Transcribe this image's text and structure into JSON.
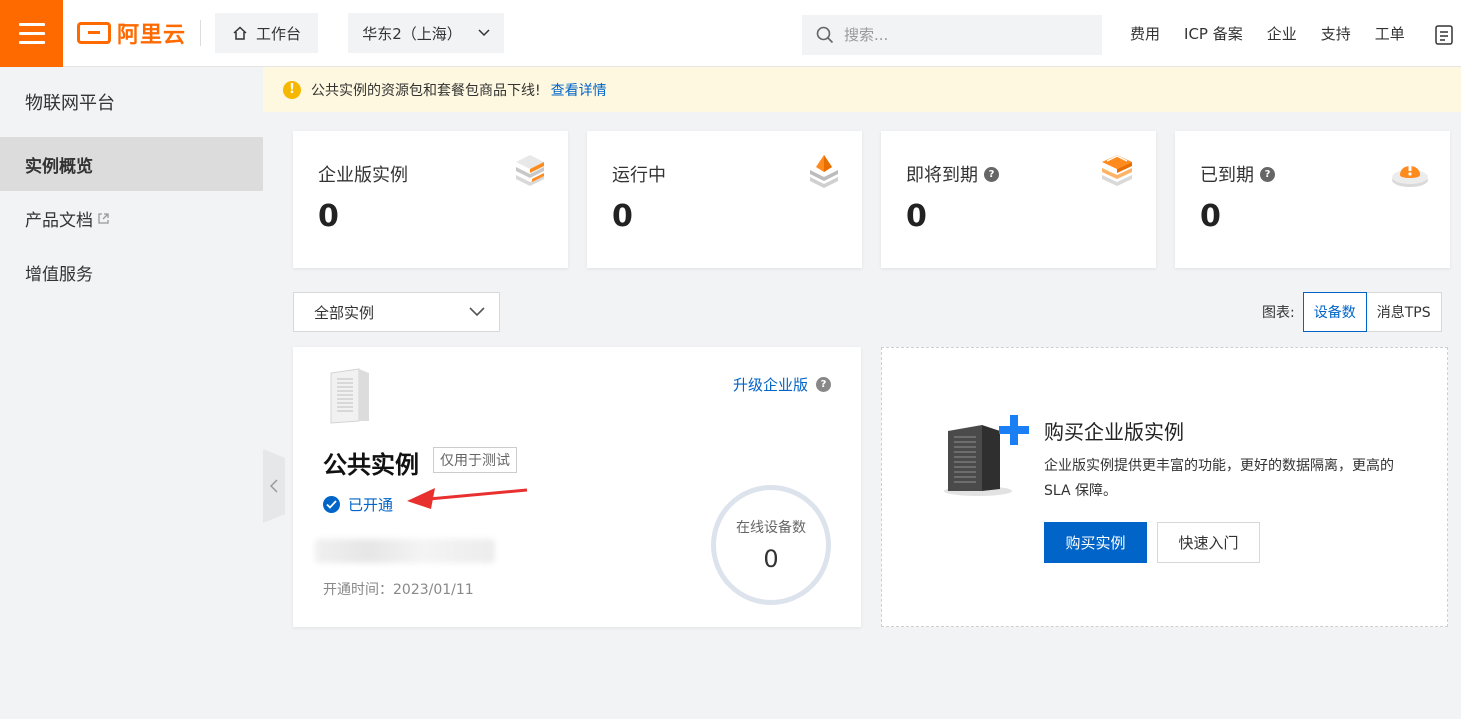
{
  "topbar": {
    "logo_text": "阿里云",
    "workbench_label": "工作台",
    "region_label": "华东2（上海）",
    "search_placeholder": "搜索...",
    "links": [
      "费用",
      "ICP 备案",
      "企业",
      "支持",
      "工单"
    ]
  },
  "sidebar": {
    "title": "物联网平台",
    "items": [
      {
        "label": "实例概览",
        "active": true
      },
      {
        "label": "产品文档",
        "external": true
      },
      {
        "label": "增值服务"
      }
    ]
  },
  "notice": {
    "text": "公共实例的资源包和套餐包商品下线!",
    "link": "查看详情"
  },
  "stats": [
    {
      "label": "企业版实例",
      "value": "0",
      "has_help": false
    },
    {
      "label": "运行中",
      "value": "0",
      "has_help": false
    },
    {
      "label": "即将到期",
      "value": "0",
      "has_help": true
    },
    {
      "label": "已到期",
      "value": "0",
      "has_help": true
    }
  ],
  "filter": {
    "instance_select": "全部实例",
    "chart_label": "图表:",
    "chart_options": [
      "设备数",
      "消息TPS"
    ],
    "chart_selected": "设备数"
  },
  "public_instance": {
    "upgrade_label": "升级企业版",
    "title": "公共实例",
    "tag": "仅用于测试",
    "status": "已开通",
    "open_time": "开通时间：2023/01/11",
    "gauge_label": "在线设备数",
    "gauge_value": "0"
  },
  "buy": {
    "title": "购买企业版实例",
    "desc": "企业版实例提供更丰富的功能，更好的数据隔离，更高的 SLA 保障。",
    "buy_button": "购买实例",
    "quick_button": "快速入门"
  },
  "colors": {
    "brand": "#ff6a00",
    "primary": "#0064c8",
    "notice_bg": "#fff8e0",
    "annotation": "#e8312f"
  }
}
